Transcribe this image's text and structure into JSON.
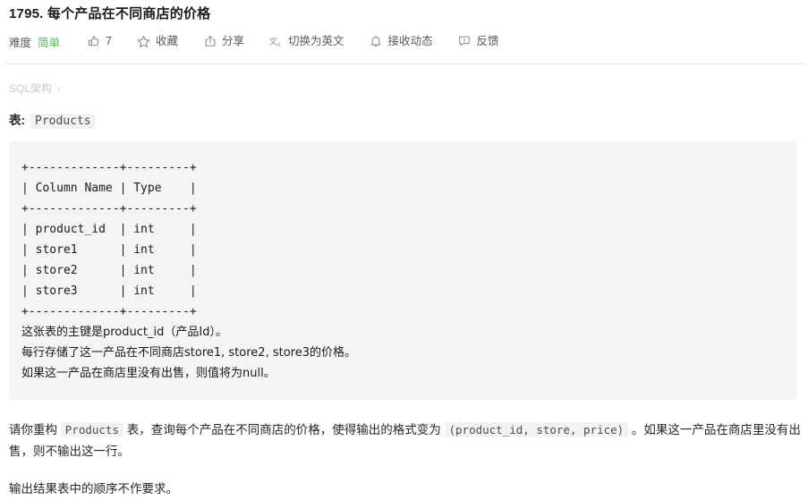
{
  "problem": {
    "title": "1795. 每个产品在不同商店的价格"
  },
  "toolbar": {
    "difficulty_label": "难度",
    "difficulty_value": "简单",
    "difficulty_color": "#5cb85c",
    "items": [
      {
        "icon": "thumbs-up-icon",
        "label": "7"
      },
      {
        "icon": "star-icon",
        "label": "收藏"
      },
      {
        "icon": "share-icon",
        "label": "分享"
      },
      {
        "icon": "translate-icon",
        "label": "切换为英文"
      },
      {
        "icon": "bell-icon",
        "label": "接收动态"
      },
      {
        "icon": "feedback-icon",
        "label": "反馈"
      }
    ]
  },
  "breadcrumb": {
    "text": "SQL架构",
    "chevron": "›"
  },
  "schema": {
    "caption_label": "表:",
    "caption_table": "Products",
    "ascii_table": "+-------------+---------+\n| Column Name | Type    |\n+-------------+---------+\n| product_id  | int     |\n| store1      | int     |\n| store2      | int     |\n| store3      | int     |\n+-------------+---------+",
    "notes": [
      "这张表的主键是product_id（产品Id）。",
      "每行存储了这一产品在不同商店store1, store2, store3的价格。",
      "如果这一产品在商店里没有出售，则值将为null。"
    ]
  },
  "description": {
    "p1_before": "请你重构 ",
    "p1_code1": "Products",
    "p1_middle": " 表，查询每个产品在不同商店的价格，使得输出的格式变为 ",
    "p1_code2": "(product_id, store, price)",
    "p1_after": " 。如果这一产品在商店里没有出售，则不输出这一行。",
    "p2": "输出结果表中的顺序不作要求。"
  }
}
